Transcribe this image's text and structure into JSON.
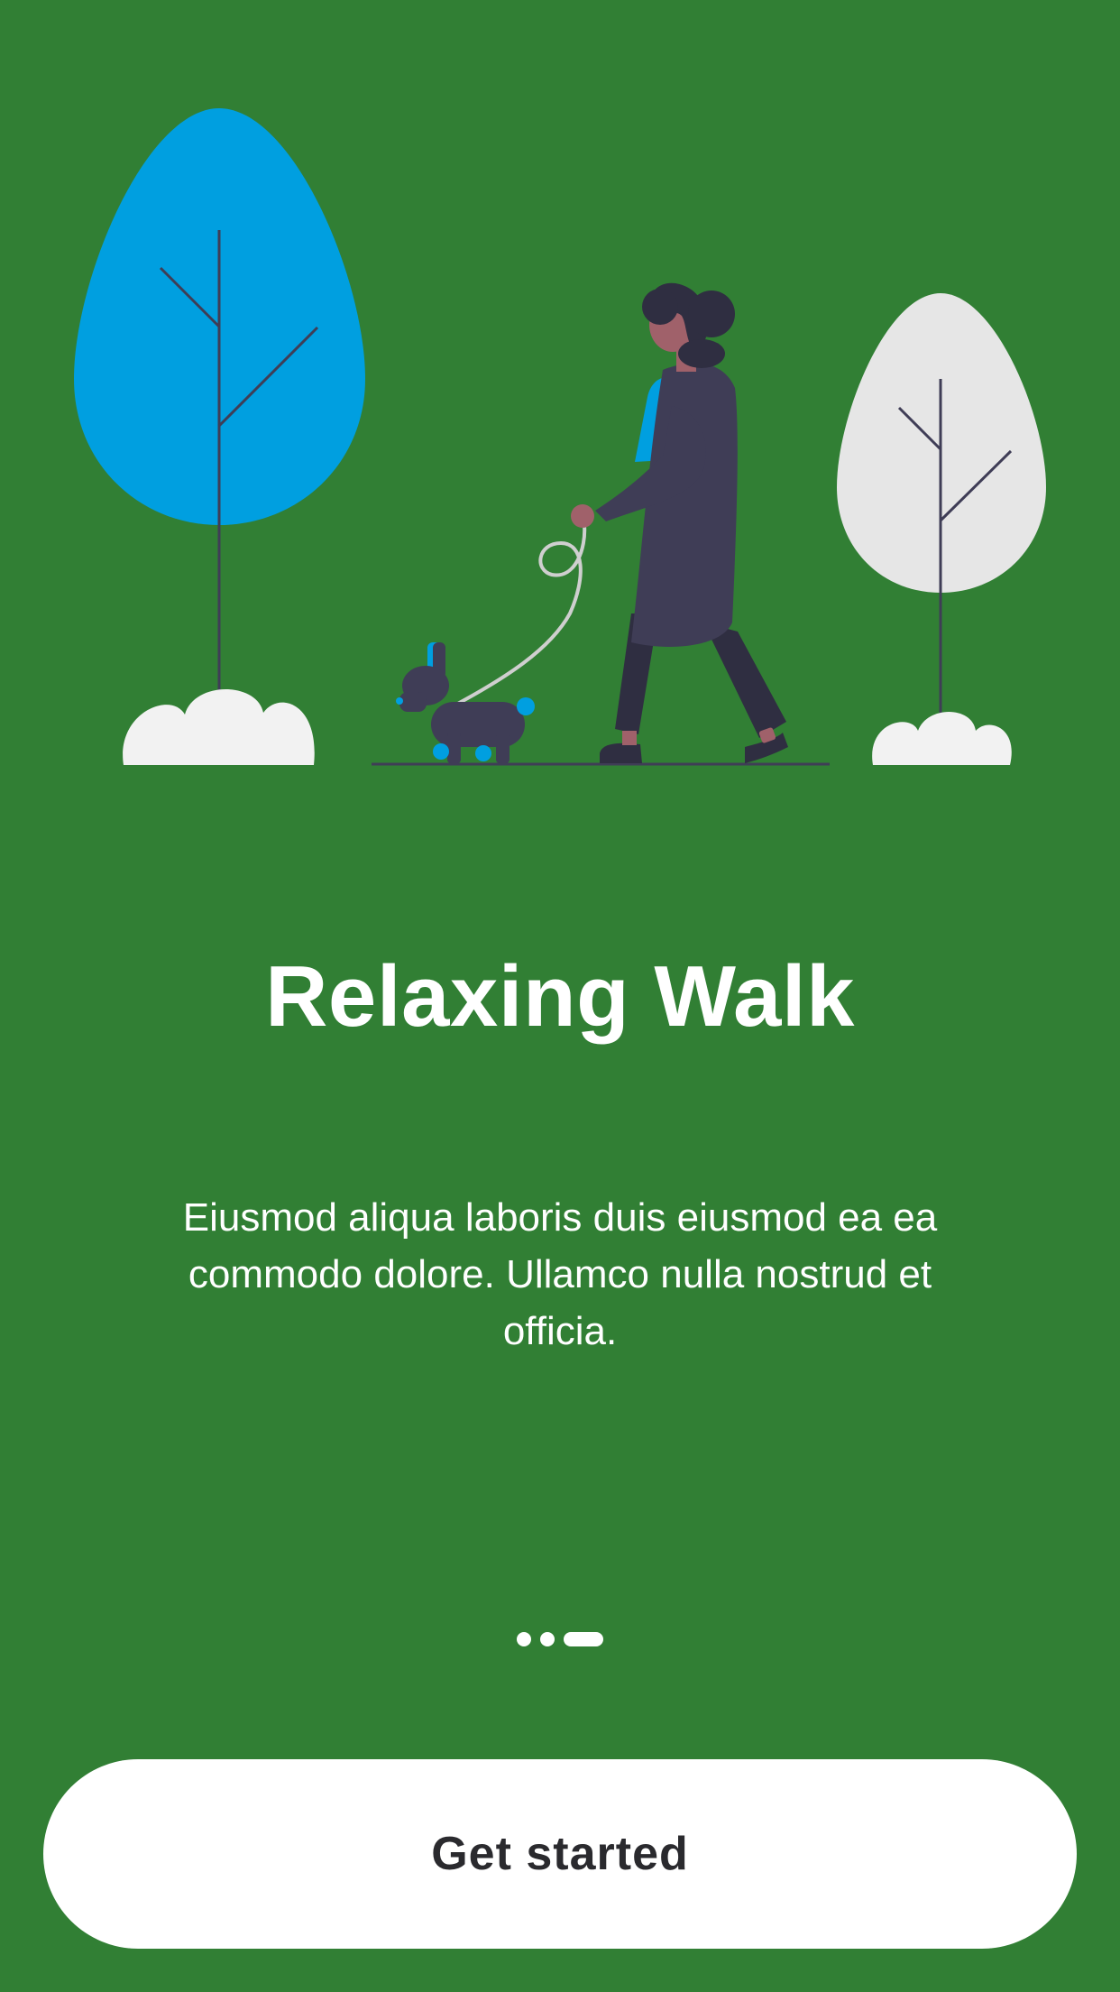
{
  "colors": {
    "background": "#317f34",
    "button_bg": "#ffffff",
    "button_text": "#2a2a2e",
    "accent_blue": "#009fe0",
    "tree_light": "#e6e6e6",
    "figure_dark": "#3f3d56"
  },
  "onboarding": {
    "illustration": "walking-dog-icon",
    "title": "Relaxing Walk",
    "description": "Eiusmod aliqua laboris duis eiusmod ea ea commodo dolore. Ullamco nulla nostrud et officia.",
    "pages": 3,
    "current_page": 3,
    "cta_label": "Get started"
  }
}
